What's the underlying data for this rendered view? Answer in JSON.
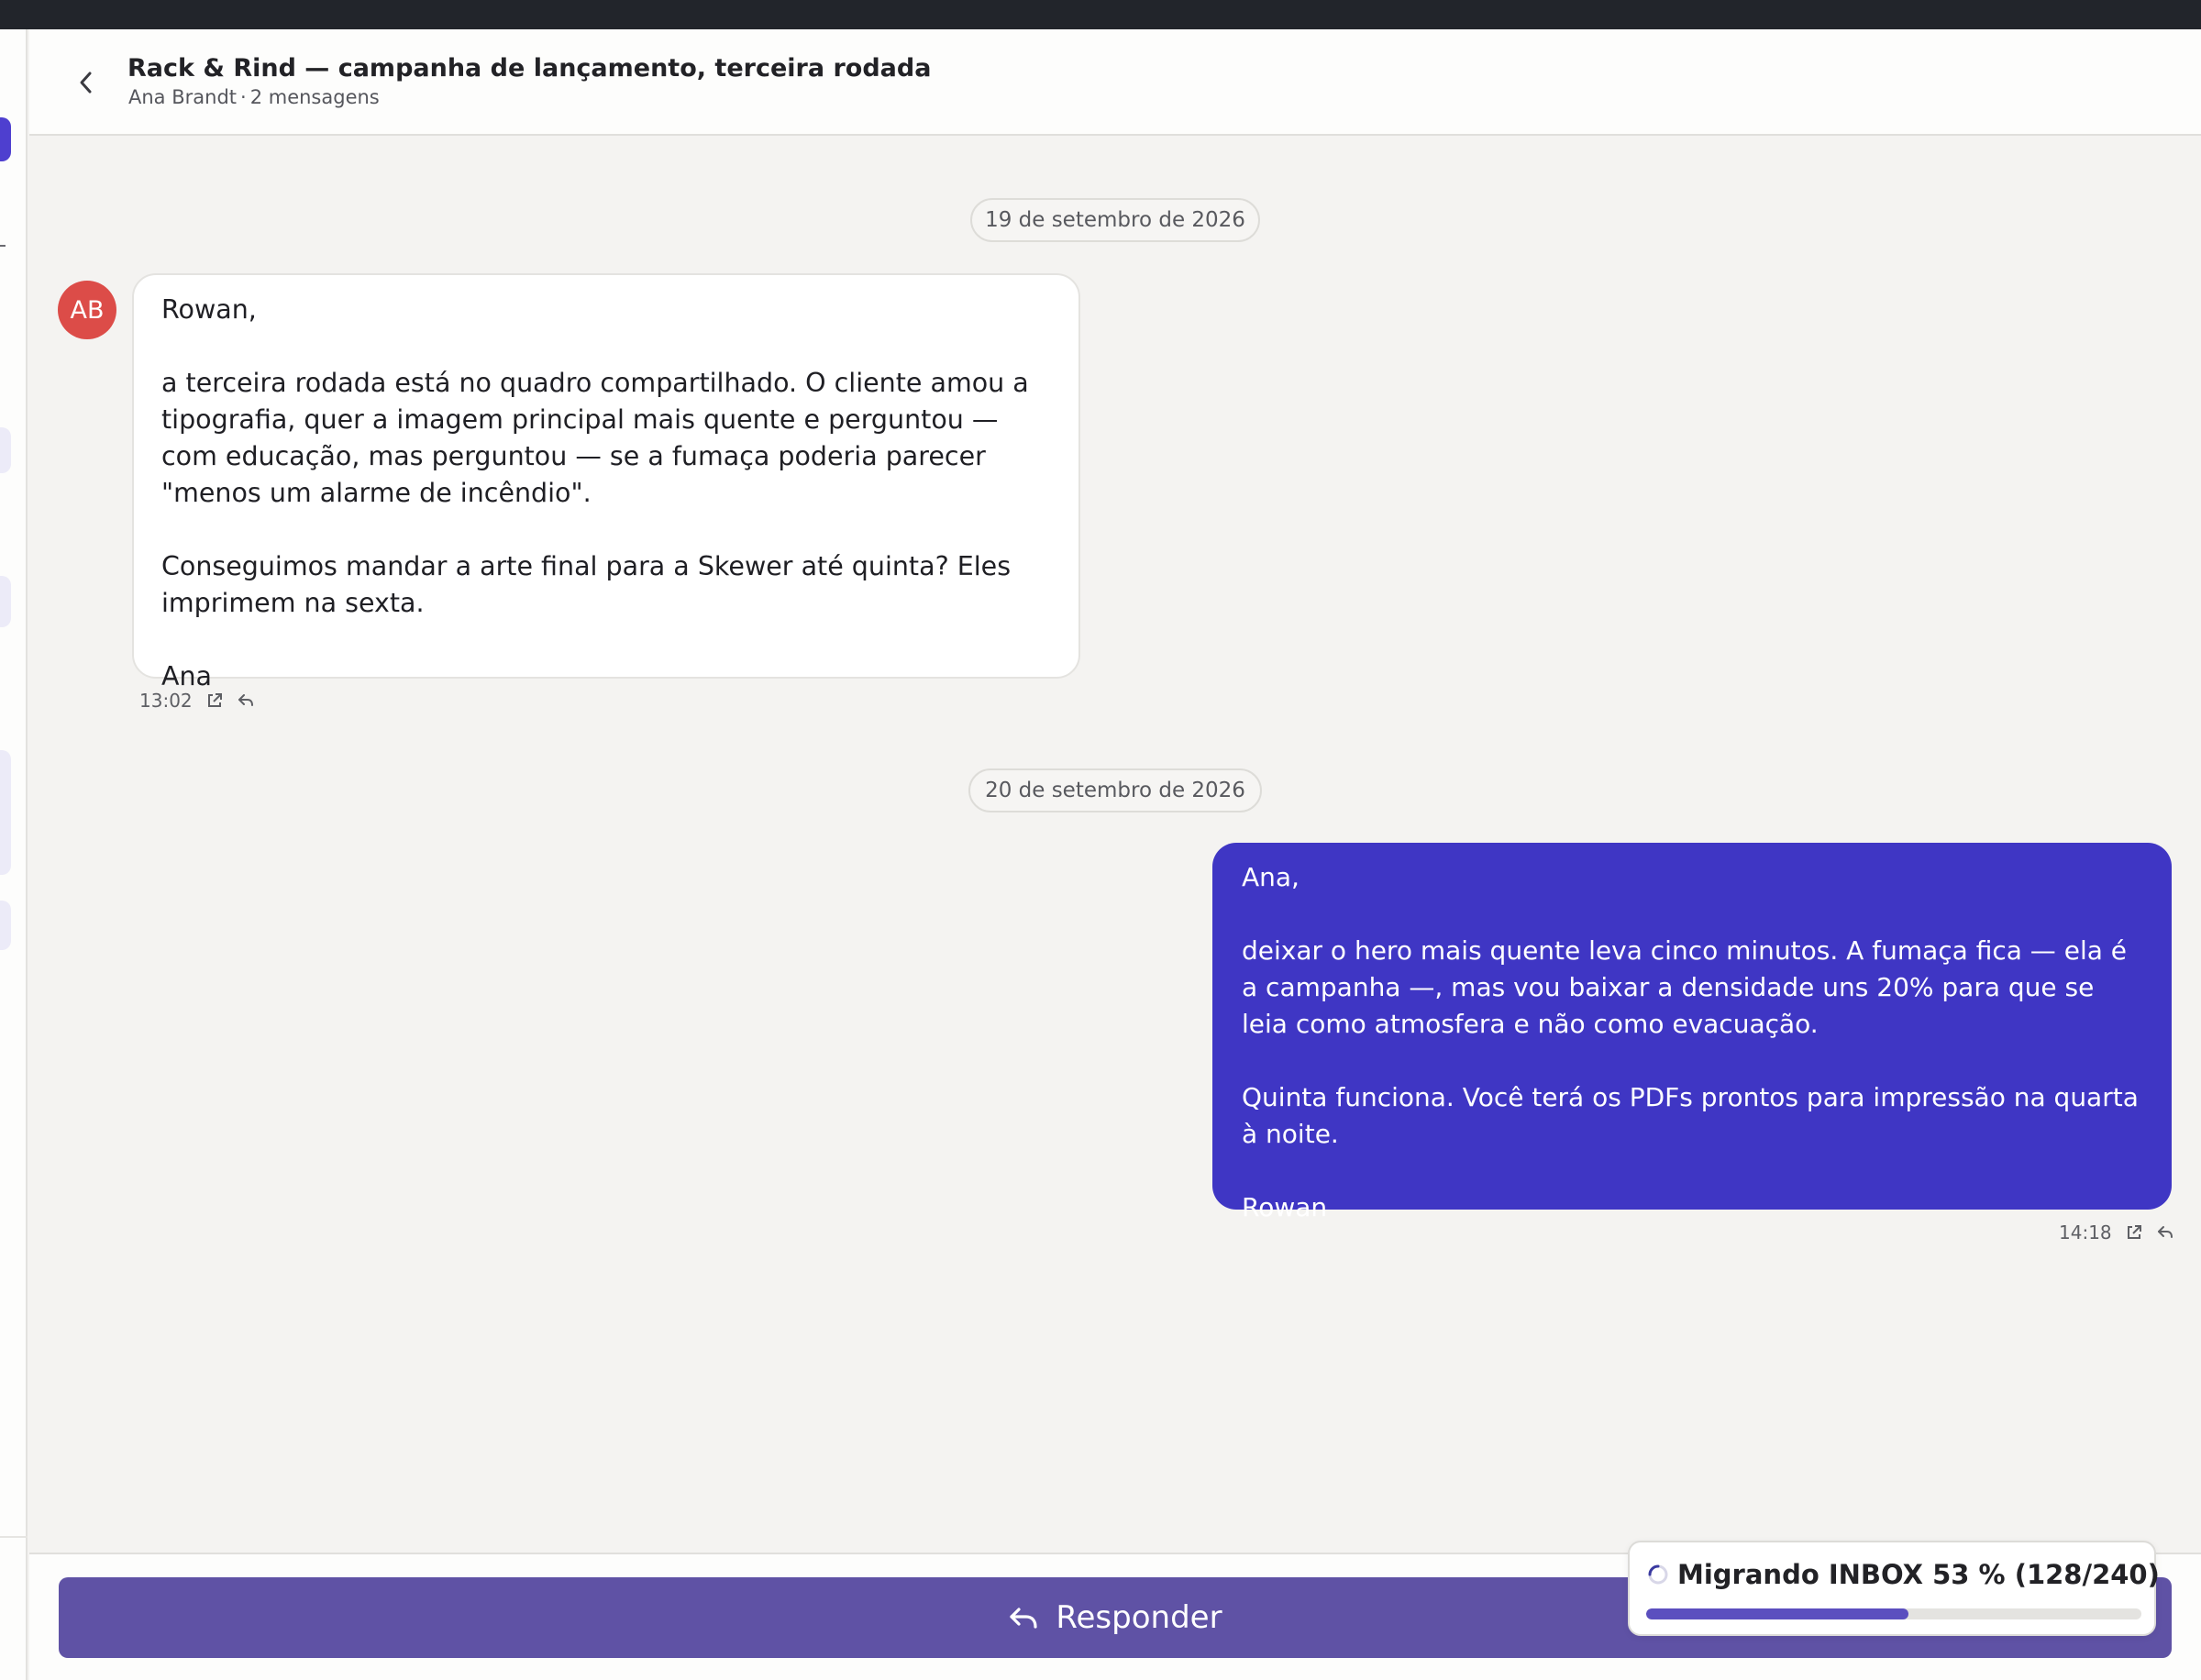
{
  "window": {
    "thread_title": "Rack & Rind — campanha de lançamento, terceira rodada",
    "sender_name": "Ana Brandt",
    "separator": "·",
    "message_count": "2 mensagens"
  },
  "messages": [
    {
      "date_label": "19 de setembro de 2026",
      "direction": "incoming",
      "avatar_initials": "AB",
      "avatar_color": "#dc4c48",
      "paragraphs": [
        "Rowan,",
        "a terceira rodada está no quadro compartilhado. O cliente amou a tipografia, quer a imagem principal mais quente e perguntou — com educação, mas perguntou — se a fumaça poderia parecer \"menos um alarme de incêndio\".",
        "Conseguimos mandar a arte final para a Skewer até quinta? Eles imprimem na sexta.",
        "Ana"
      ],
      "time": "13:02"
    },
    {
      "date_label": "20 de setembro de 2026",
      "direction": "outgoing",
      "bubble_color": "#3f36c4",
      "paragraphs": [
        "Ana,",
        "deixar o hero mais quente leva cinco minutos. A fumaça fica — ela é a campanha —, mas vou baixar a densidade uns 20% para que se leia como atmosfera e não como evacuação.",
        "Quinta funciona. Você terá os PDFs prontos para impressão na quarta à noite.",
        "Rowan"
      ],
      "time": "14:18"
    }
  ],
  "icons": {
    "back": "chevron-left-icon",
    "open_external": "external-link-icon",
    "reply": "reply-arrow-icon",
    "spinner": "spinner-icon"
  },
  "footer": {
    "reply_label": "Responder"
  },
  "migration": {
    "label": "Migrando INBOX 53 % (128/240)",
    "progress": 0.53
  },
  "colors": {
    "accent": "#3f36c4",
    "reply_button": "#5f52a5",
    "progress_fill": "#5b4fbf"
  }
}
